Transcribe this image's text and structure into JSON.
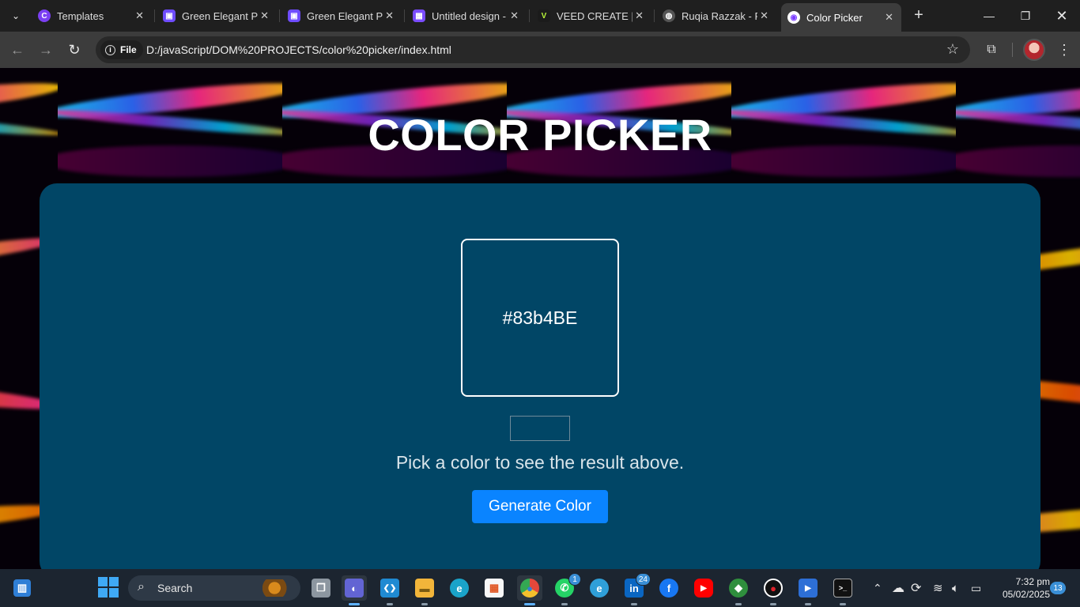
{
  "browser": {
    "tabs": [
      {
        "title": "Templates",
        "icon": "canva-icon",
        "color": "#7b3ff2",
        "glyph": "C"
      },
      {
        "title": "Green Elegant Pr",
        "icon": "printer-icon",
        "color": "#6e4cff",
        "glyph": "▣"
      },
      {
        "title": "Green Elegant Pr",
        "icon": "printer-icon",
        "color": "#6e4cff",
        "glyph": "▣"
      },
      {
        "title": "Untitled design -",
        "icon": "clapper-icon",
        "color": "#7a4cff",
        "glyph": "▦"
      },
      {
        "title": "VEED CREATE | E",
        "icon": "veed-icon",
        "color": "#1b1b1b",
        "glyph": "V"
      },
      {
        "title": "Ruqia Razzak - P",
        "icon": "globe-icon",
        "color": "#555",
        "glyph": "◍"
      },
      {
        "title": "Color Picker",
        "icon": "color-picker-favicon",
        "color": "#ffffff",
        "glyph": "◉"
      }
    ],
    "new_tab": "+",
    "file_label": "File",
    "url": "D:/javaScript/DOM%20PROJECTS/color%20picker/index.html"
  },
  "page": {
    "title": "COLOR PICKER",
    "color_value": "#83b4BE",
    "hint": "Pick a color to see the result above.",
    "button_label": "Generate Color",
    "card_color": "#014666",
    "button_color": "#0a84ff"
  },
  "taskbar": {
    "search_label": "Search",
    "apps": [
      {
        "name": "task-view",
        "icon": "task-view-icon",
        "color": "#8c96a0",
        "glyph": "❐"
      },
      {
        "name": "meet",
        "icon": "video-call-icon",
        "color": "#6264d3",
        "glyph": "◐",
        "active": true
      },
      {
        "name": "vscode",
        "icon": "vscode-icon",
        "color": "#1f8ad2",
        "glyph": "❮❯"
      },
      {
        "name": "file-explorer",
        "icon": "folder-icon",
        "color": "#f2b53a",
        "glyph": "▬"
      },
      {
        "name": "edge",
        "icon": "edge-icon",
        "color": "#1aa3c9",
        "glyph": "e"
      },
      {
        "name": "store",
        "icon": "store-icon",
        "color": "#f7f7f7",
        "glyph": "▦"
      },
      {
        "name": "chrome",
        "icon": "chrome-icon",
        "color": "#e5483b",
        "glyph": "◉",
        "active": true
      },
      {
        "name": "whatsapp",
        "icon": "whatsapp-icon",
        "color": "#25d366",
        "glyph": "✆",
        "badge": "1"
      },
      {
        "name": "edge-beta",
        "icon": "edge-beta-icon",
        "color": "#2f9fd8",
        "glyph": "e"
      },
      {
        "name": "linkedin",
        "icon": "linkedin-icon",
        "color": "#0a66c2",
        "glyph": "in",
        "badge": "24"
      },
      {
        "name": "facebook",
        "icon": "facebook-icon",
        "color": "#1877f2",
        "glyph": "f"
      },
      {
        "name": "youtube",
        "icon": "youtube-icon",
        "color": "#ff0000",
        "glyph": "▶"
      },
      {
        "name": "network-tool",
        "icon": "globe-arrow-icon",
        "color": "#2f8f3d",
        "glyph": "◆"
      },
      {
        "name": "recorder",
        "icon": "record-icon",
        "color": "#111111",
        "glyph": "●"
      },
      {
        "name": "media-player",
        "icon": "media-player-icon",
        "color": "#2d6fd6",
        "glyph": "▶"
      },
      {
        "name": "terminal",
        "icon": "terminal-icon",
        "color": "#111111",
        "glyph": ">_"
      }
    ],
    "time": "7:32 pm",
    "date": "05/02/2025",
    "notifications": "13"
  }
}
